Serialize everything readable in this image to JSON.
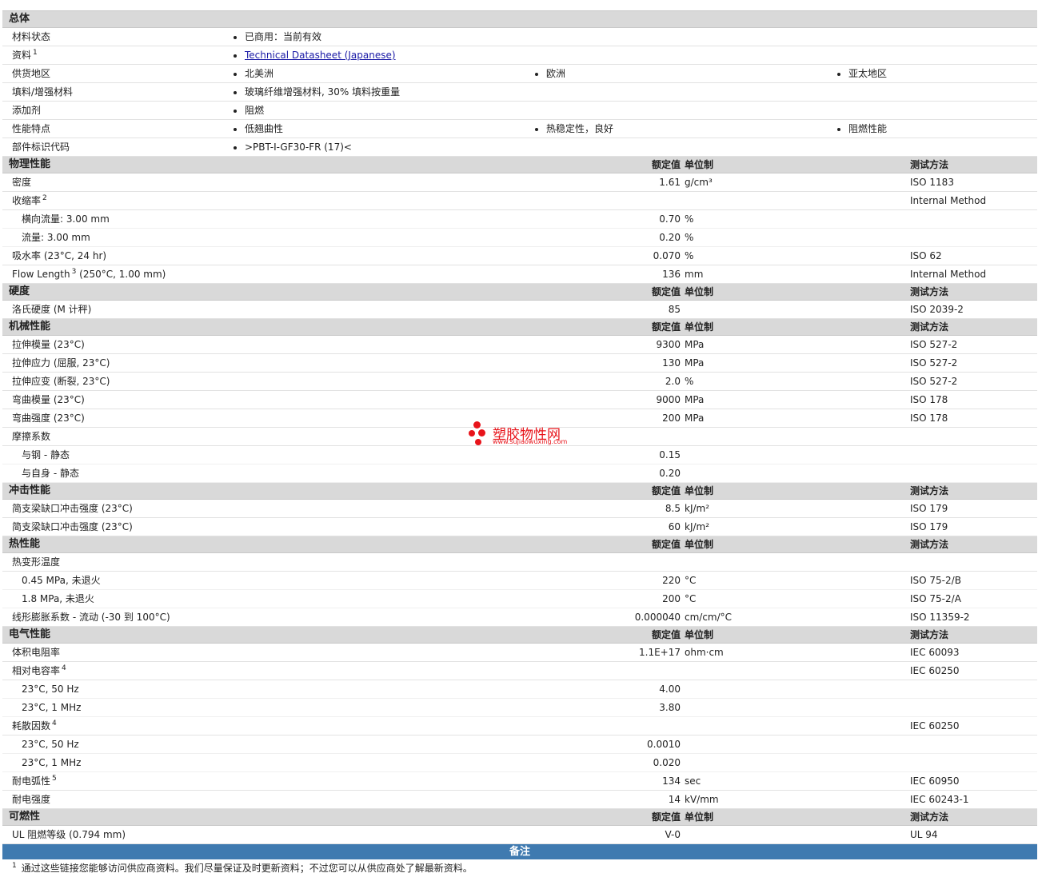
{
  "sections": [
    {
      "title": "总体",
      "type": "general",
      "rows": [
        {
          "name": "材料状态",
          "values": [
            "已商用：当前有效"
          ]
        },
        {
          "name": "资料",
          "sup": "1",
          "link": "Technical Datasheet (Japanese)"
        },
        {
          "name": "供货地区",
          "values": [
            "北美洲",
            "欧洲",
            "亚太地区"
          ]
        },
        {
          "name": "填料/增强材料",
          "values": [
            "玻璃纤维增强材料, 30% 填料按重量"
          ]
        },
        {
          "name": "添加剂",
          "values": [
            "阻燃"
          ]
        },
        {
          "name": "性能特点",
          "values": [
            "低翘曲性",
            "热稳定性，良好",
            "阻燃性能"
          ]
        },
        {
          "name": "部件标识代码",
          "values": [
            ">PBT-I-GF30-FR (17)<"
          ]
        }
      ]
    },
    {
      "title": "物理性能",
      "headers": {
        "nominal": "额定值",
        "unit": "单位制",
        "method": "测试方法"
      },
      "rows": [
        {
          "name": "密度",
          "value": "1.61",
          "unit": "g/cm³",
          "method": "ISO 1183"
        },
        {
          "name": "收缩率",
          "sup": "2",
          "method": "Internal Method"
        },
        {
          "name": "横向流量: 3.00 mm",
          "sub": true,
          "value": "0.70",
          "unit": "%"
        },
        {
          "name": "流量: 3.00 mm",
          "sub": true,
          "value": "0.20",
          "unit": "%"
        },
        {
          "name": "吸水率 (23°C, 24 hr)",
          "value": "0.070",
          "unit": "%",
          "method": "ISO 62"
        },
        {
          "name": "Flow Length",
          "sup": "3",
          "suffix": " (250°C, 1.00 mm)",
          "value": "136",
          "unit": "mm",
          "method": "Internal Method"
        }
      ]
    },
    {
      "title": "硬度",
      "headers": {
        "nominal": "额定值",
        "unit": "单位制",
        "method": "测试方法"
      },
      "rows": [
        {
          "name": "洛氏硬度 (M 计秤)",
          "value": "85",
          "method": "ISO 2039-2"
        }
      ]
    },
    {
      "title": "机械性能",
      "headers": {
        "nominal": "额定值",
        "unit": "单位制",
        "method": "测试方法"
      },
      "rows": [
        {
          "name": "拉伸模量 (23°C)",
          "value": "9300",
          "unit": "MPa",
          "method": "ISO 527-2"
        },
        {
          "name": "拉伸应力 (屈服, 23°C)",
          "value": "130",
          "unit": "MPa",
          "method": "ISO 527-2"
        },
        {
          "name": "拉伸应变 (断裂, 23°C)",
          "value": "2.0",
          "unit": "%",
          "method": "ISO 527-2"
        },
        {
          "name": "弯曲模量 (23°C)",
          "value": "9000",
          "unit": "MPa",
          "method": "ISO 178"
        },
        {
          "name": "弯曲强度 (23°C)",
          "value": "200",
          "unit": "MPa",
          "method": "ISO 178"
        },
        {
          "name": "摩擦系数"
        },
        {
          "name": "与钢 - 静态",
          "sub": true,
          "value": "0.15"
        },
        {
          "name": "与自身 - 静态",
          "sub": true,
          "value": "0.20"
        }
      ]
    },
    {
      "title": "冲击性能",
      "headers": {
        "nominal": "额定值",
        "unit": "单位制",
        "method": "测试方法"
      },
      "rows": [
        {
          "name": "简支梁缺口冲击强度 (23°C)",
          "value": "8.5",
          "unit": "kJ/m²",
          "method": "ISO 179"
        },
        {
          "name": "简支梁缺口冲击强度 (23°C)",
          "value": "60",
          "unit": "kJ/m²",
          "method": "ISO 179"
        }
      ]
    },
    {
      "title": "热性能",
      "headers": {
        "nominal": "额定值",
        "unit": "单位制",
        "method": "测试方法"
      },
      "rows": [
        {
          "name": "热变形温度"
        },
        {
          "name": "0.45 MPa, 未退火",
          "sub": true,
          "value": "220",
          "unit": "°C",
          "method": "ISO 75-2/B"
        },
        {
          "name": "1.8 MPa, 未退火",
          "sub": true,
          "value": "200",
          "unit": "°C",
          "method": "ISO 75-2/A"
        },
        {
          "name": "线形膨胀系数 - 流动 (-30 到 100°C)",
          "value": "0.000040",
          "unit": "cm/cm/°C",
          "method": "ISO 11359-2"
        }
      ]
    },
    {
      "title": "电气性能",
      "headers": {
        "nominal": "额定值",
        "unit": "单位制",
        "method": "测试方法"
      },
      "rows": [
        {
          "name": "体积电阻率",
          "value": "1.1E+17",
          "unit": "ohm·cm",
          "method": "IEC 60093"
        },
        {
          "name": "相对电容率",
          "sup": "4",
          "method": "IEC 60250"
        },
        {
          "name": "23°C, 50 Hz",
          "sub": true,
          "value": "4.00"
        },
        {
          "name": "23°C, 1 MHz",
          "sub": true,
          "value": "3.80"
        },
        {
          "name": "耗散因数",
          "sup": "4",
          "method": "IEC 60250"
        },
        {
          "name": "23°C, 50 Hz",
          "sub": true,
          "value": "0.0010"
        },
        {
          "name": "23°C, 1 MHz",
          "sub": true,
          "value": "0.020"
        },
        {
          "name": "耐电弧性",
          "sup": "5",
          "value": "134",
          "unit": "sec",
          "method": "IEC 60950"
        },
        {
          "name": "耐电强度",
          "value": "14",
          "unit": "kV/mm",
          "method": "IEC 60243-1"
        }
      ]
    },
    {
      "title": "可燃性",
      "headers": {
        "nominal": "额定值",
        "unit": "单位制",
        "method": "测试方法"
      },
      "rows": [
        {
          "name": "UL 阻燃等级 (0.794 mm)",
          "value": "V-0",
          "method": "UL 94"
        }
      ]
    }
  ],
  "notes": {
    "title": "备注",
    "footnotes": [
      {
        "num": "1",
        "text": "通过这些链接您能够访问供应商资料。我们尽量保证及时更新资料；不过您可以从供应商处了解最新资料。"
      }
    ]
  },
  "watermark": {
    "title": "塑胶物性网",
    "url": "www.sujiaowuxing.com",
    "color": "#e8141b"
  }
}
